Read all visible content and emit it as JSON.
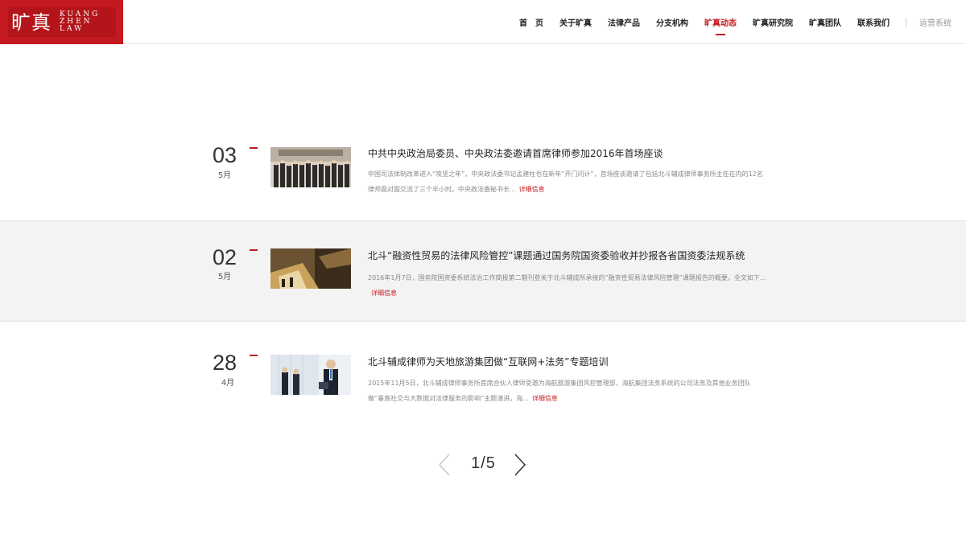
{
  "brand": {
    "name_cn": "旷真",
    "name_en_lines": [
      "KUANG",
      "ZHEN",
      "LAW"
    ]
  },
  "nav": {
    "items": [
      {
        "label": "首　页"
      },
      {
        "label": "关于旷真"
      },
      {
        "label": "法律产品"
      },
      {
        "label": "分支机构"
      },
      {
        "label": "旷真动态",
        "active": true
      },
      {
        "label": "旷真研究院"
      },
      {
        "label": "旷真团队"
      },
      {
        "label": "联系我们"
      }
    ],
    "system_link": "运营系统"
  },
  "news": [
    {
      "day": "03",
      "month": "5月",
      "title": "中共中央政治局委员、中央政法委邀请首席律师参加2016年首场座谈",
      "desc": "中国司法体制改革进入“攻坚之年”，中央政法委书记孟建柱也在新年“开门问计”，首场座谈邀请了包括北斗辅成律师事务所主任在内的12名律师面对面交流了三个半小时。中央政法委秘书长...",
      "more": "详细信息",
      "thumb": "group-photo-image"
    },
    {
      "day": "02",
      "month": "5月",
      "title": "北斗“融资性贸易的法律风险管控”课题通过国务院国资委验收并抄报各省国资委法规系统",
      "desc": "2016年1月7日，国务院国资委系统法治工作简报第二期刊登关于北斗辅成所承接的“融资性贸易法律风险管理”课题报告的概要，全文如下...",
      "more": "详细信息",
      "thumb": "documents-image"
    },
    {
      "day": "28",
      "month": "4月",
      "title": "北斗辅成律师为天地旅游集团做“互联网+法务”专题培训",
      "desc": "2015年11月5日，北斗辅成律师事务所首席合伙人律师受邀为海航旅游集团风控管理部、海航集团法务系统的公司法务及其他业务团队做“垂直社交与大数据对法律服务的影响”主题演讲，海...",
      "more": "详细信息",
      "thumb": "business-people-image"
    }
  ],
  "pager": {
    "current": "1",
    "separator": "/",
    "total": "5"
  },
  "colors": {
    "brand_red": "#c41a1f",
    "alt_row": "#f3f3f3"
  }
}
